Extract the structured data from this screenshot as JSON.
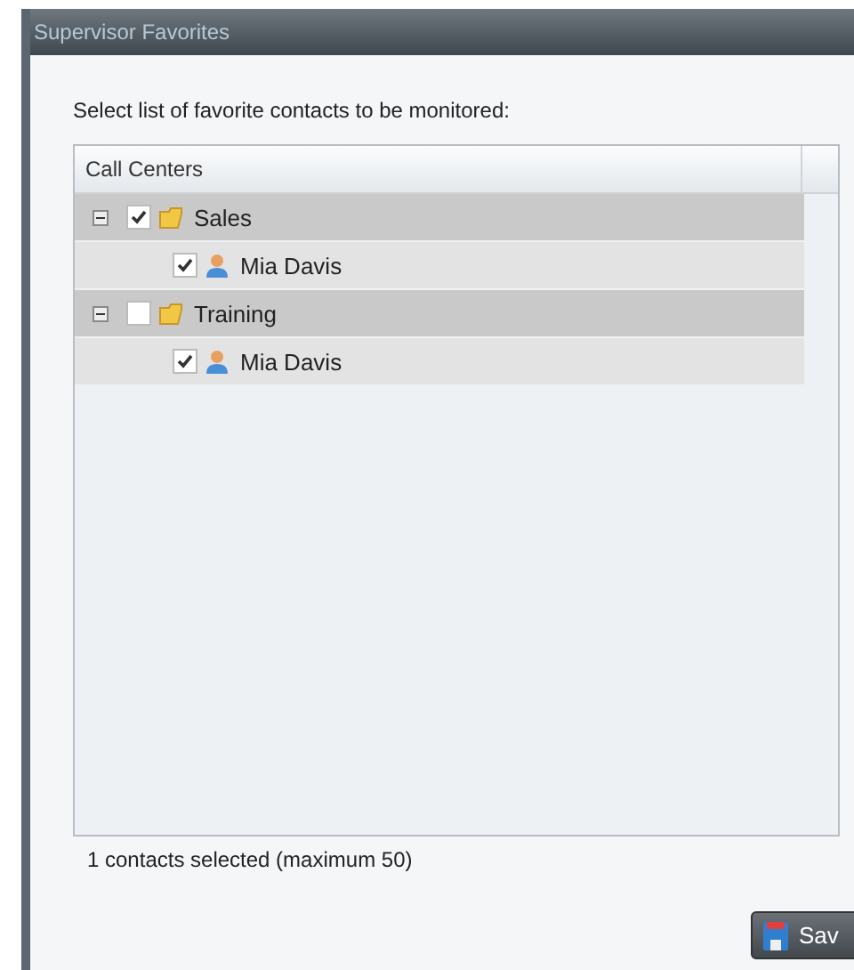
{
  "window": {
    "title": "Supervisor Favorites"
  },
  "instruction": "Select list of favorite contacts to be monitored:",
  "tree": {
    "column": "Call Centers",
    "items": [
      {
        "label": "Sales",
        "expanded": true,
        "checked": true,
        "children": [
          {
            "label": "Mia Davis",
            "checked": true
          }
        ]
      },
      {
        "label": "Training",
        "expanded": true,
        "checked": false,
        "children": [
          {
            "label": "Mia Davis",
            "checked": true
          }
        ]
      }
    ]
  },
  "status": "1 contacts selected (maximum 50)",
  "buttons": [
    {
      "label": "Sav"
    }
  ]
}
